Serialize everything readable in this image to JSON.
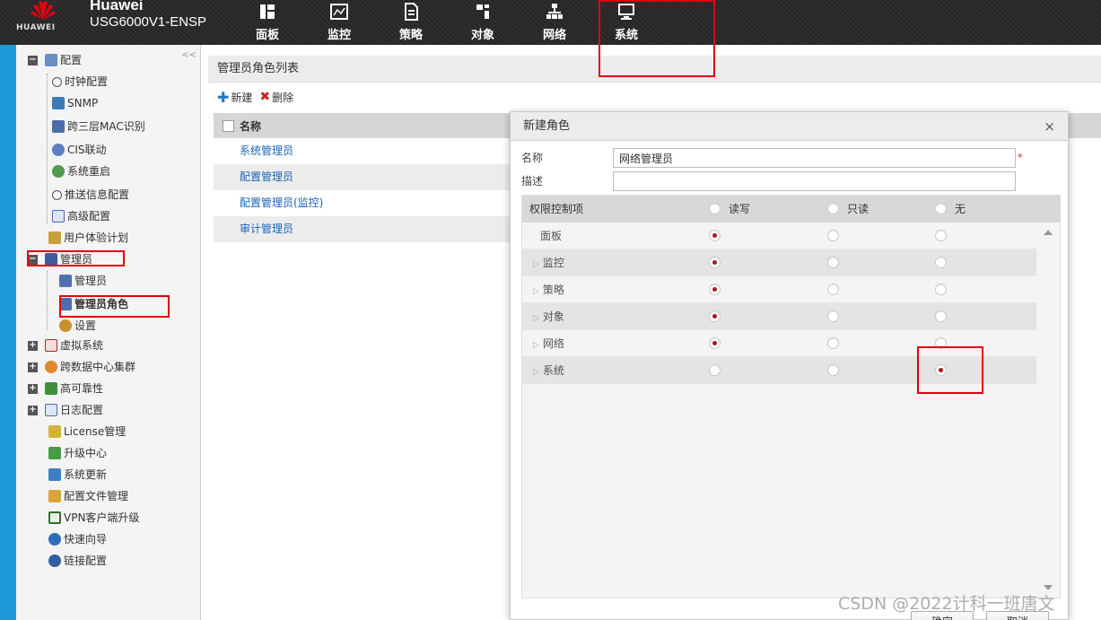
{
  "app": {
    "brand_name": "Huawei",
    "brand_logo_text": "HUAWEI",
    "device": "USG6000V1-ENSP"
  },
  "nav": [
    {
      "label": "面板",
      "icon": "dashboard-icon"
    },
    {
      "label": "监控",
      "icon": "monitor-chart-icon"
    },
    {
      "label": "策略",
      "icon": "policy-document-icon"
    },
    {
      "label": "对象",
      "icon": "object-icon"
    },
    {
      "label": "网络",
      "icon": "network-icon"
    },
    {
      "label": "系统",
      "icon": "system-monitor-icon",
      "active": true
    }
  ],
  "sidebar": {
    "collapse_glyph": "<<",
    "items": [
      {
        "label": "配置",
        "level": 0,
        "expander": "−"
      },
      {
        "label": "时钟配置",
        "level": 1
      },
      {
        "label": "SNMP",
        "level": 1
      },
      {
        "label": "跨三层MAC识别",
        "level": 1
      },
      {
        "label": "CIS联动",
        "level": 1
      },
      {
        "label": "系统重启",
        "level": 1
      },
      {
        "label": "推送信息配置",
        "level": 1
      },
      {
        "label": "高级配置",
        "level": 1
      },
      {
        "label": "用户体验计划",
        "level": 0
      },
      {
        "label": "管理员",
        "level": 0,
        "expander": "−"
      },
      {
        "label": "管理员",
        "level": 1
      },
      {
        "label": "管理员角色",
        "level": 1,
        "selected": true
      },
      {
        "label": "设置",
        "level": 1
      },
      {
        "label": "虚拟系统",
        "level": 0,
        "expander": "+"
      },
      {
        "label": "跨数据中心集群",
        "level": 0,
        "expander": "+"
      },
      {
        "label": "高可靠性",
        "level": 0,
        "expander": "+"
      },
      {
        "label": "日志配置",
        "level": 0,
        "expander": "+"
      },
      {
        "label": "License管理",
        "level": 0
      },
      {
        "label": "升级中心",
        "level": 0
      },
      {
        "label": "系统更新",
        "level": 0
      },
      {
        "label": "配置文件管理",
        "level": 0
      },
      {
        "label": "VPN客户端升级",
        "level": 0
      },
      {
        "label": "快速向导",
        "level": 0
      },
      {
        "label": "链接配置",
        "level": 0
      }
    ]
  },
  "main": {
    "panel_title": "管理员角色列表",
    "toolbar": {
      "new_label": "新建",
      "delete_label": "删除"
    },
    "column_name": "名称",
    "rows": [
      "系统管理员",
      "配置管理员",
      "配置管理员(监控)",
      "审计管理员"
    ]
  },
  "dialog": {
    "title": "新建角色",
    "close_glyph": "×",
    "name_label": "名称",
    "name_value": "网络管理员",
    "required_mark": "*",
    "desc_label": "描述",
    "desc_value": "",
    "perm_header": "权限控制项",
    "options": [
      "读写",
      "只读",
      "无"
    ],
    "permissions": [
      {
        "label": "面板",
        "expandable": false,
        "selected": 0
      },
      {
        "label": "监控",
        "expandable": true,
        "selected": 0
      },
      {
        "label": "策略",
        "expandable": true,
        "selected": 0
      },
      {
        "label": "对象",
        "expandable": true,
        "selected": 0
      },
      {
        "label": "网络",
        "expandable": true,
        "selected": 0
      },
      {
        "label": "系统",
        "expandable": true,
        "selected": 2
      }
    ],
    "ok_label": "确定",
    "cancel_label": "取消"
  },
  "colors": {
    "accent_stripe": "#1e9bd7",
    "highlight": "#e3000f",
    "radio_selected": "#b01818",
    "link": "#1a63b8"
  },
  "watermark": "CSDN @2022计科一班唐文"
}
